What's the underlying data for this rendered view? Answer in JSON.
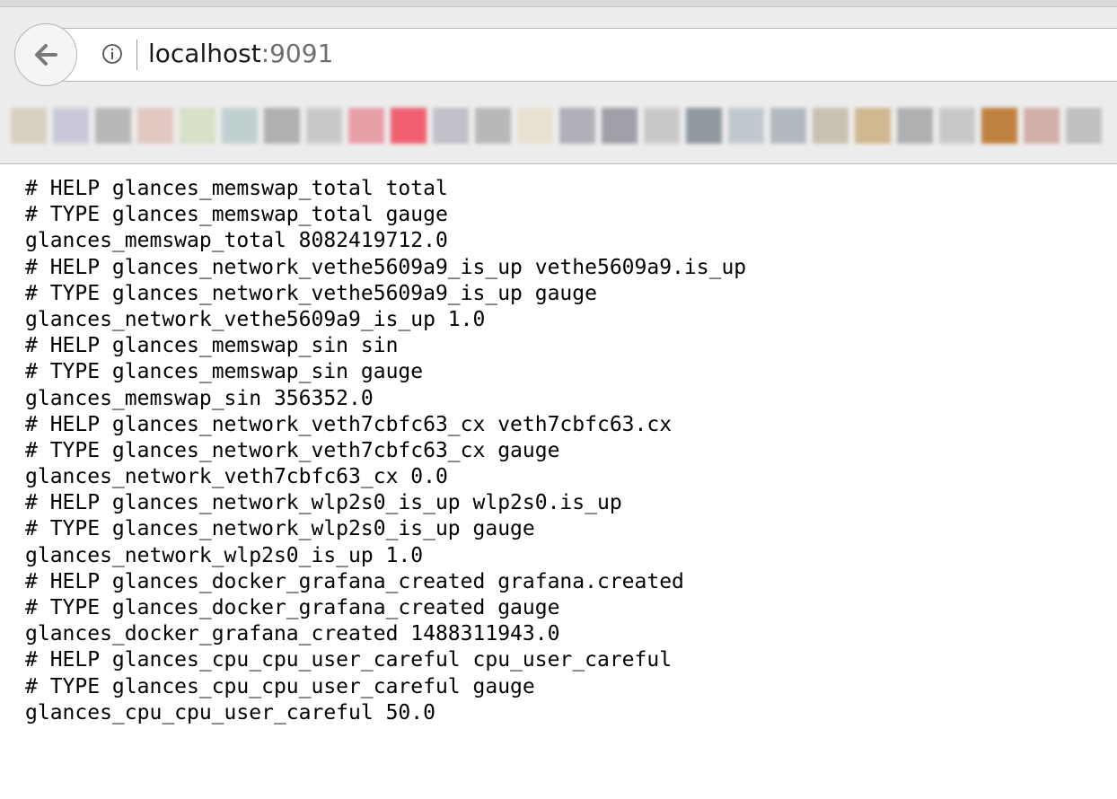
{
  "browser": {
    "url_host": "localhost",
    "url_port": ":9091",
    "back_icon": "back-arrow-icon",
    "info_icon": "info-icon",
    "bookmark_colors": [
      "#d8d0c0",
      "#c8c8d8",
      "#b8b8b8",
      "#e0c8c0",
      "#d8e0c8",
      "#c0d0d0",
      "#b0b0b0",
      "#c8c8c8",
      "#e8a0a8",
      "#f06070",
      "#c0c0c8",
      "#b8b8b8",
      "#e8e0d0",
      "#b0b0b8",
      "#a0a0a8",
      "#c8c8c8",
      "#9098a0",
      "#c0c8d0",
      "#b0b8c0",
      "#c8c0b0",
      "#d0b890",
      "#b0b0b0",
      "#c8c8c8",
      "#c08040",
      "#d0b0a8",
      "#c0c0c0"
    ]
  },
  "body": {
    "lines": [
      "# HELP glances_memswap_total total",
      "# TYPE glances_memswap_total gauge",
      "glances_memswap_total 8082419712.0",
      "# HELP glances_network_vethe5609a9_is_up vethe5609a9.is_up",
      "# TYPE glances_network_vethe5609a9_is_up gauge",
      "glances_network_vethe5609a9_is_up 1.0",
      "# HELP glances_memswap_sin sin",
      "# TYPE glances_memswap_sin gauge",
      "glances_memswap_sin 356352.0",
      "# HELP glances_network_veth7cbfc63_cx veth7cbfc63.cx",
      "# TYPE glances_network_veth7cbfc63_cx gauge",
      "glances_network_veth7cbfc63_cx 0.0",
      "# HELP glances_network_wlp2s0_is_up wlp2s0.is_up",
      "# TYPE glances_network_wlp2s0_is_up gauge",
      "glances_network_wlp2s0_is_up 1.0",
      "# HELP glances_docker_grafana_created grafana.created",
      "# TYPE glances_docker_grafana_created gauge",
      "glances_docker_grafana_created 1488311943.0",
      "# HELP glances_cpu_cpu_user_careful cpu_user_careful",
      "# TYPE glances_cpu_cpu_user_careful gauge",
      "glances_cpu_cpu_user_careful 50.0"
    ]
  }
}
